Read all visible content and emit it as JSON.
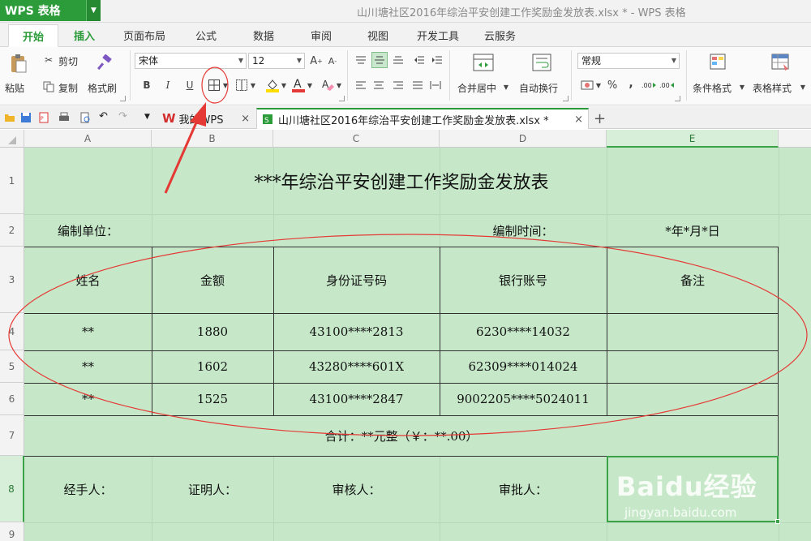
{
  "app": {
    "name": "WPS 表格",
    "window_title": "山川塘社区2016年综治平安创建工作奖励金发放表.xlsx * - WPS 表格"
  },
  "menu": {
    "tabs": [
      "开始",
      "插入",
      "页面布局",
      "公式",
      "数据",
      "审阅",
      "视图",
      "开发工具",
      "云服务"
    ]
  },
  "ribbon": {
    "paste": "粘贴",
    "cut": "剪切",
    "copy": "复制",
    "format_painter": "格式刷",
    "font_name": "宋体",
    "font_size": "12",
    "bold": "B",
    "italic": "I",
    "underline": "U",
    "merge_center": "合并居中",
    "wrap_text": "自动换行",
    "number_format": "常规",
    "percent": "%",
    "comma": ",",
    "cond_format": "条件格式",
    "table_style": "表格样式"
  },
  "doc_tabs": {
    "home": "我的WPS",
    "file": "山川塘社区2016年综治平安创建工作奖励金发放表.xlsx *"
  },
  "columns": [
    "A",
    "B",
    "C",
    "D",
    "E"
  ],
  "rows": [
    "1",
    "2",
    "3",
    "4",
    "5",
    "6",
    "7",
    "8",
    "9"
  ],
  "sheet": {
    "title": "***年综治平安创建工作奖励金发放表",
    "unit_label": "编制单位：",
    "time_label": "编制时间：",
    "time_value": "*年*月*日",
    "headers": [
      "姓名",
      "金额",
      "身份证号码",
      "银行账号",
      "备注"
    ],
    "records": [
      [
        "**",
        "1880",
        "43100****2813",
        "6230****14032",
        ""
      ],
      [
        "**",
        "1602",
        "43280****601X",
        "62309****014024",
        ""
      ],
      [
        "**",
        "1525",
        "43100****2847",
        "9002205****5024011",
        ""
      ]
    ],
    "total": "合计：**元整（￥：**.00）",
    "signatures": [
      "经手人：",
      "证明人：",
      "审核人：",
      "审批人："
    ]
  },
  "watermark": {
    "logo": "Baidu经验",
    "url": "jingyan.baidu.com"
  },
  "colors": {
    "accent": "#2c9b3a",
    "sheet_bg": "#c6e8c9",
    "annotation": "#e53935"
  }
}
